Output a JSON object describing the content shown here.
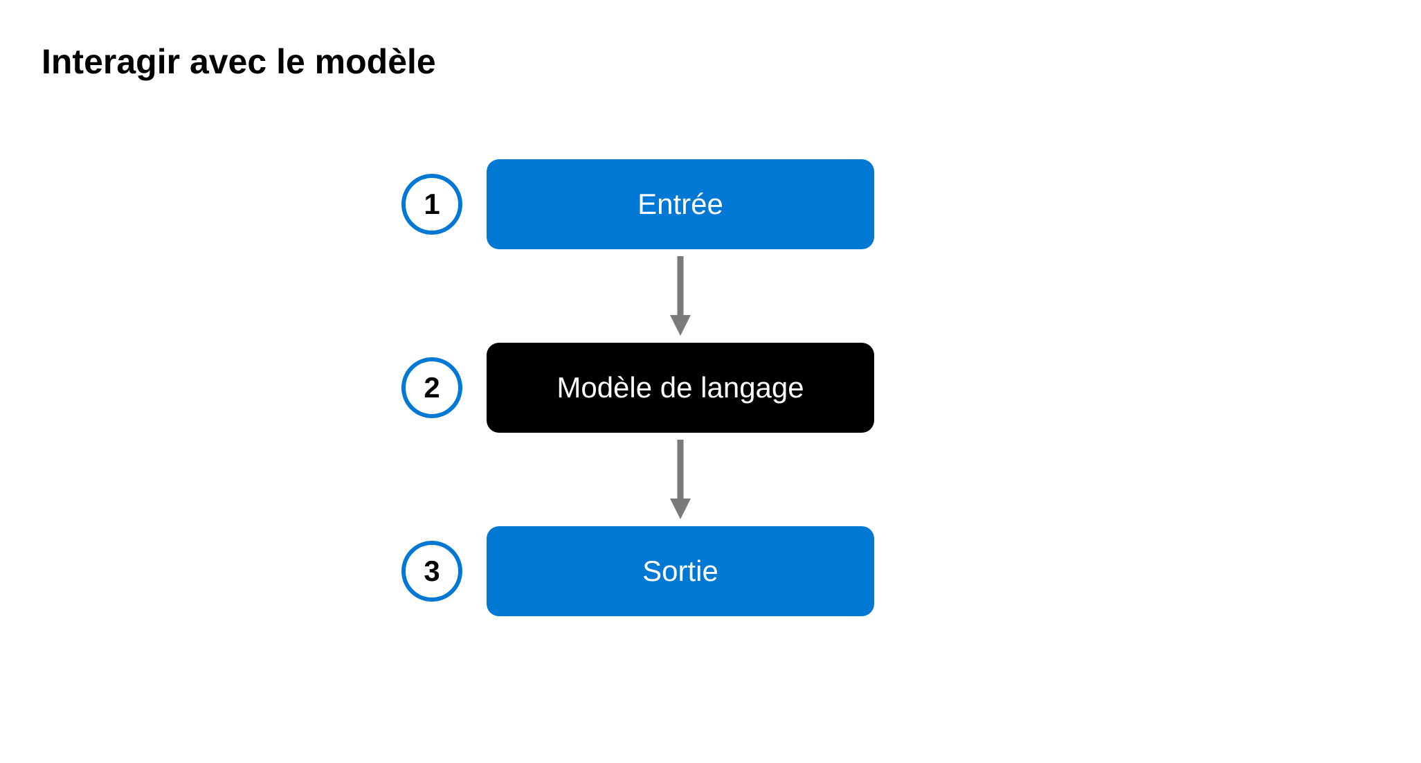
{
  "title": "Interagir avec le modèle",
  "steps": [
    {
      "number": "1",
      "label": "Entrée",
      "style": "blue"
    },
    {
      "number": "2",
      "label": "Modèle de langage",
      "style": "black"
    },
    {
      "number": "3",
      "label": "Sortie",
      "style": "blue"
    }
  ],
  "colors": {
    "accent": "#0078d4",
    "arrow": "#7a7a7a",
    "dark": "#000000"
  }
}
